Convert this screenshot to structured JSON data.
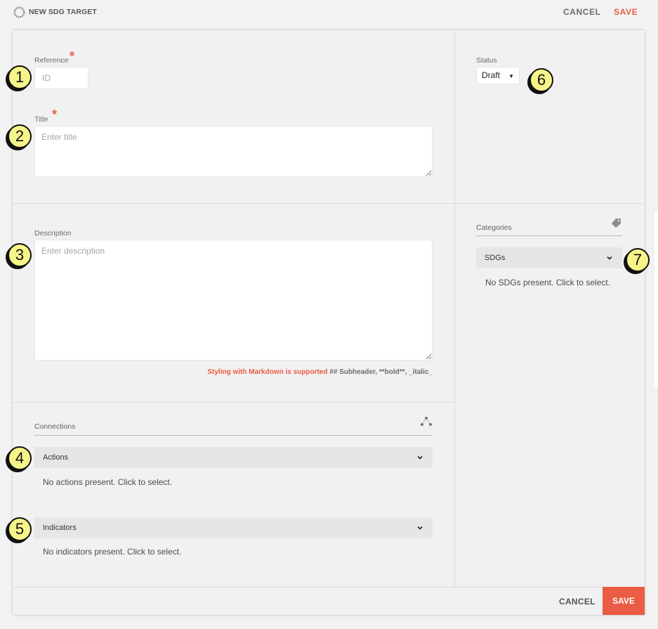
{
  "header": {
    "app_title": "NEW SDG TARGET",
    "cancel_label": "CANCEL",
    "save_label": "SAVE"
  },
  "form": {
    "reference": {
      "label": "Reference",
      "required_mark": "*",
      "placeholder": "ID",
      "value": ""
    },
    "title": {
      "label": "Title",
      "required_mark": "*",
      "placeholder": "Enter title",
      "value": ""
    },
    "description": {
      "label": "Description",
      "placeholder": "Enter description",
      "value": ""
    },
    "markdown_hint": {
      "accent": "Styling with Markdown is supported",
      "rest": " ## Subheader, **bold**, _italic_"
    }
  },
  "connections": {
    "title": "Connections",
    "icon": "network-icon",
    "groups": [
      {
        "label": "Actions",
        "empty_text": "No actions present. Click to select."
      },
      {
        "label": "Indicators",
        "empty_text": "No indicators present. Click to select."
      }
    ]
  },
  "status": {
    "label": "Status",
    "selected": "Draft"
  },
  "categories": {
    "title": "Categories",
    "icon": "tag-icon",
    "groups": [
      {
        "label": "SDGs",
        "empty_text": "No SDGs present. Click to select."
      }
    ]
  },
  "footer": {
    "cancel_label": "CANCEL",
    "save_label": "SAVE"
  },
  "annotations": [
    "1",
    "2",
    "3",
    "4",
    "5",
    "6",
    "7"
  ],
  "colors": {
    "accent": "#ea5c45",
    "background": "#f1f2f1",
    "annotation_fill": "#f6f589"
  }
}
